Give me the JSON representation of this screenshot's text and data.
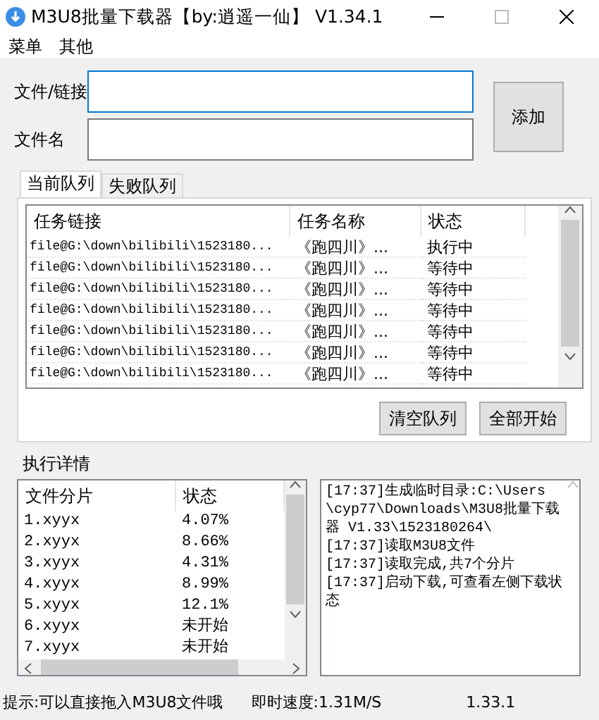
{
  "window": {
    "title": "M3U8批量下载器【by:逍遥一仙】 V1.34.1"
  },
  "menu": [
    "菜单",
    "其他"
  ],
  "fields": [
    {
      "label": "文件/链接",
      "focused": true
    },
    {
      "label": "文件名",
      "focused": false
    }
  ],
  "add_button": "添加",
  "tabs": [
    {
      "label": "当前队列",
      "selected": true
    },
    {
      "label": "失败队列",
      "selected": false
    }
  ],
  "queue": {
    "columns": [
      "任务链接",
      "任务名称",
      "状态"
    ],
    "rows": [
      [
        "file@G:\\down\\bilibili\\1523180...",
        "《跑四川》...",
        "执行中"
      ],
      [
        "file@G:\\down\\bilibili\\1523180...",
        "《跑四川》...",
        "等待中"
      ],
      [
        "file@G:\\down\\bilibili\\1523180...",
        "《跑四川》...",
        "等待中"
      ],
      [
        "file@G:\\down\\bilibili\\1523180...",
        "《跑四川》...",
        "等待中"
      ],
      [
        "file@G:\\down\\bilibili\\1523180...",
        "《跑四川》...",
        "等待中"
      ],
      [
        "file@G:\\down\\bilibili\\1523180...",
        "《跑四川》...",
        "等待中"
      ],
      [
        "file@G:\\down\\bilibili\\1523180...",
        "《跑四川》...",
        "等待中"
      ]
    ]
  },
  "queue_buttons": [
    "清空队列",
    "全部开始"
  ],
  "details": {
    "title": "执行详情",
    "columns": [
      "文件分片",
      "状态"
    ],
    "rows": [
      [
        "1.xyyx",
        "4.07%"
      ],
      [
        "2.xyyx",
        "8.66%"
      ],
      [
        "3.xyyx",
        "4.31%"
      ],
      [
        "4.xyyx",
        "8.99%"
      ],
      [
        "5.xyyx",
        "12.1%"
      ],
      [
        "6.xyyx",
        "未开始"
      ],
      [
        "7.xyyx",
        "未开始"
      ]
    ],
    "log": [
      "[17:37]生成临时目录:C:\\Users\\cyp77\\Downloads\\M3U8批量下载器 V1.33\\1523180264\\",
      "[17:37]读取M3U8文件",
      "[17:37]读取完成,共7个分片",
      "[17:37]启动下载,可查看左侧下载状态"
    ]
  },
  "status_bar": [
    "提示:可以直接拖入M3U8文件哦",
    "即时速度:1.31M/S",
    "1.33.1"
  ]
}
